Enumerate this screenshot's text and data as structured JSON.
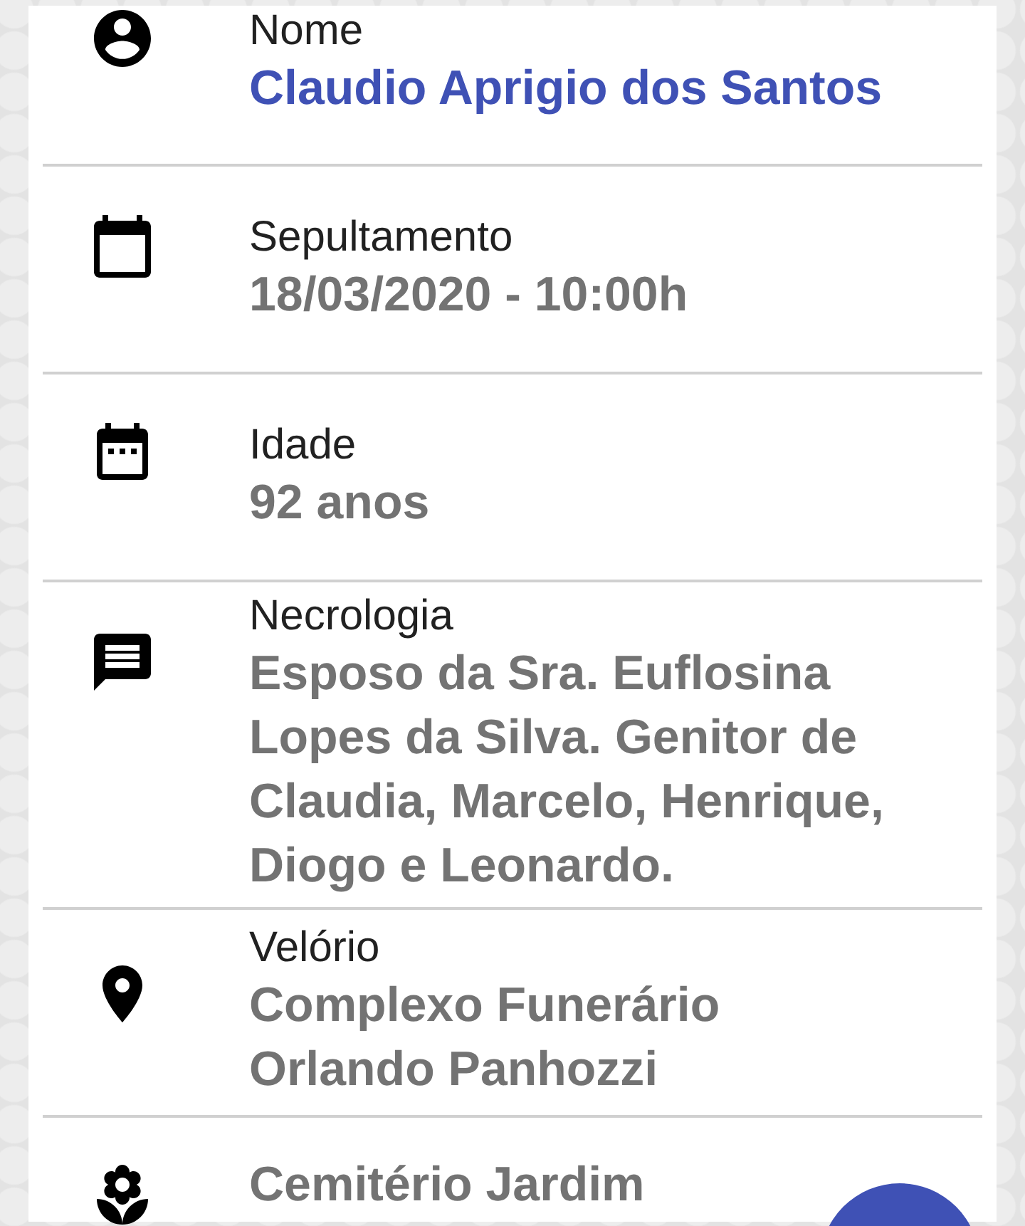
{
  "card": {
    "fields": [
      {
        "kind": "name",
        "label": "Nome",
        "value": "Claudio Aprigio dos Santos"
      },
      {
        "kind": "burial",
        "label": "Sepultamento",
        "value": "18/03/2020 - 10:00h"
      },
      {
        "kind": "age",
        "label": "Idade",
        "value": "92 anos"
      },
      {
        "kind": "obituary",
        "label": "Necrologia",
        "value": "Esposo da Sra. Euflosina Lopes da Silva. Genitor de Claudia, Marcelo, Henrique, Diogo e Leonardo."
      },
      {
        "kind": "wake",
        "label": "Velório",
        "value": "Complexo Funerário Orlando Panhozzi"
      },
      {
        "kind": "cemetery",
        "value": "Cemitério Jardim"
      }
    ]
  }
}
